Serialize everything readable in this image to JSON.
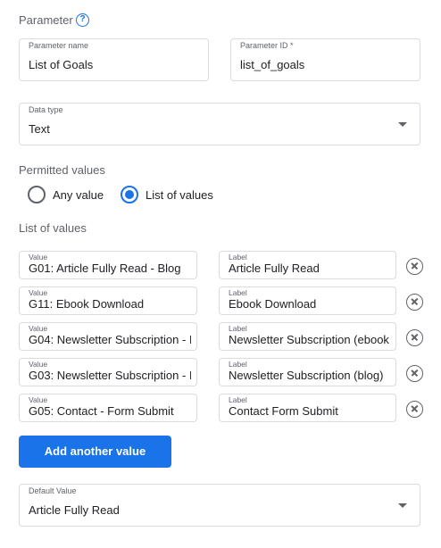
{
  "parameter": {
    "heading": "Parameter",
    "help_icon": "help-circle-icon",
    "name_label": "Parameter name",
    "name_value": "List of Goals",
    "id_label": "Parameter ID *",
    "id_value": "list_of_goals"
  },
  "data_type": {
    "label": "Data type",
    "value": "Text"
  },
  "permitted_values": {
    "heading": "Permitted values",
    "options": [
      {
        "label": "Any value",
        "selected": false
      },
      {
        "label": "List of values",
        "selected": true
      }
    ]
  },
  "list_of_values": {
    "heading": "List of values",
    "value_label": "Value",
    "label_label": "Label",
    "remove_icon": "remove-circle-x-icon",
    "rows": [
      {
        "value": "G01: Article Fully Read - Blog",
        "label": "Article Fully Read"
      },
      {
        "value": "G11: Ebook Download",
        "label": "Ebook Download"
      },
      {
        "value": "G04: Newsletter Subscription - I",
        "label": "Newsletter Subscription (ebook"
      },
      {
        "value": "G03: Newsletter Subscription - I",
        "label": "Newsletter Subscription (blog)"
      },
      {
        "value": "G05: Contact - Form Submit",
        "label": "Contact Form Submit"
      }
    ]
  },
  "add_button": {
    "label": "Add another value"
  },
  "default_value": {
    "label": "Default Value",
    "value": "Article Fully Read"
  },
  "colors": {
    "accent": "#1a73e8",
    "border": "#dadce0",
    "muted_text": "#5f6368"
  }
}
